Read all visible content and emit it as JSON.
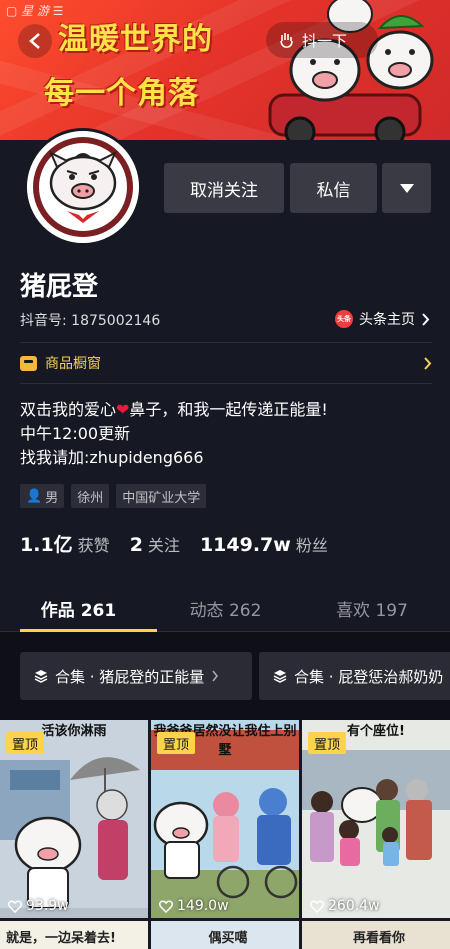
{
  "banner": {
    "line1": "温暖世界的",
    "line2": "每一个角落",
    "shake_label": "抖一下"
  },
  "profile": {
    "name": "猪屁登",
    "douyin_id": "抖音号: 1875002146",
    "toutiao_label": "头条主页",
    "toutiao_badge": "头条"
  },
  "actions": {
    "unfollow": "取消关注",
    "message": "私信"
  },
  "shop": {
    "label": "商品橱窗"
  },
  "bio": {
    "line1_a": "双击我的爱心",
    "line1_b": "鼻子，和我一起传递正能量!",
    "line2": "中午12:00更新",
    "line3": "找我请加:zhupideng666"
  },
  "tags": [
    "男",
    "徐州",
    "中国矿业大学"
  ],
  "stats": {
    "likes_num": "1.1亿",
    "likes_label": "获赞",
    "following_num": "2",
    "following_label": "关注",
    "fans_num": "1149.7w",
    "fans_label": "粉丝"
  },
  "tabs": {
    "works": "作品 261",
    "dynamics": "动态 262",
    "likes": "喜欢 197"
  },
  "collections": [
    "合集 · 猪屁登的正能量",
    "合集 · 屁登惩治郝奶奶"
  ],
  "videos": [
    {
      "pin": "置顶",
      "caption": "活该你淋雨",
      "likes": "93.9w"
    },
    {
      "pin": "置顶",
      "caption": "我爸爸居然没让我住上别墅",
      "likes": "149.0w"
    },
    {
      "pin": "置顶",
      "caption": "有个座位!",
      "likes": "260.4w"
    }
  ],
  "next_row": [
    "就是，一边呆着去!",
    "偶买噶",
    "再看看你"
  ],
  "colors": {
    "background": "#161823",
    "accent_yellow": "#fbd34c",
    "heart_red": "#e8193a",
    "button_gray": "#3a3a44"
  }
}
